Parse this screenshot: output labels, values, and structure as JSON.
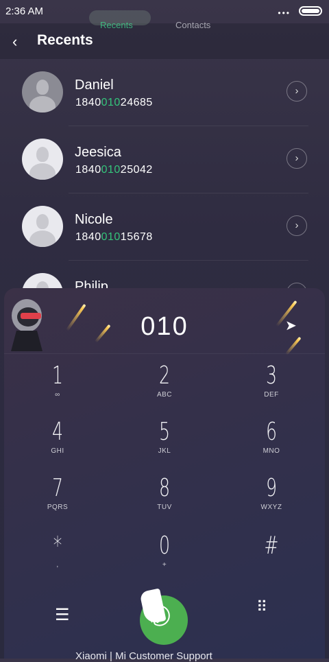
{
  "status": {
    "time": "2:36 AM",
    "dots": "•••"
  },
  "header": {
    "back": "‹",
    "title": "Recents",
    "tabs": [
      "Recents",
      "Contacts"
    ]
  },
  "recents": [
    {
      "name": "Daniel",
      "pre": "1840",
      "hl": "010",
      "post": "24685",
      "chevron": "›"
    },
    {
      "name": "Jeesica",
      "pre": "1840",
      "hl": "010",
      "post": "25042",
      "chevron": "›"
    },
    {
      "name": "Nicole",
      "pre": "1840",
      "hl": "010",
      "post": "15678",
      "chevron": "›"
    },
    {
      "name": "Philip",
      "pre": "",
      "hl": "",
      "post": "",
      "chevron": "›"
    }
  ],
  "dial": {
    "input": "010"
  },
  "keypad": [
    {
      "digit": "1",
      "letters": "∞"
    },
    {
      "digit": "2",
      "letters": "ABC"
    },
    {
      "digit": "3",
      "letters": "DEF"
    },
    {
      "digit": "4",
      "letters": "GHI"
    },
    {
      "digit": "5",
      "letters": "JKL"
    },
    {
      "digit": "6",
      "letters": "MNO"
    },
    {
      "digit": "7",
      "letters": "PQRS"
    },
    {
      "digit": "8",
      "letters": "TUV"
    },
    {
      "digit": "9",
      "letters": "WXYZ"
    },
    {
      "digit": "*",
      "letters": ","
    },
    {
      "digit": "0",
      "letters": "+"
    },
    {
      "digit": "#",
      "letters": ""
    }
  ],
  "bottom": {
    "menu": "☰",
    "keypad_icon": "⠿",
    "call": "✆",
    "footer": "Xiaomi  |  Mi Customer Support"
  }
}
